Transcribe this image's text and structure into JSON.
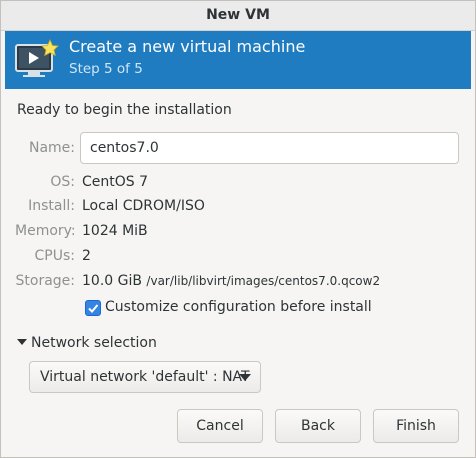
{
  "window": {
    "title": "New VM"
  },
  "header": {
    "title": "Create a new virtual machine",
    "step": "Step 5 of 5",
    "icon": "computer-with-star-icon"
  },
  "summary": {
    "heading": "Ready to begin the installation",
    "name_label": "Name:",
    "name_value": "centos7.0",
    "os_label": "OS:",
    "os_value": "CentOS 7",
    "install_label": "Install:",
    "install_value": "Local CDROM/ISO",
    "memory_label": "Memory:",
    "memory_value": "1024 MiB",
    "cpus_label": "CPUs:",
    "cpus_value": "2",
    "storage_label": "Storage:",
    "storage_size": "10.0 GiB",
    "storage_path": "/var/lib/libvirt/images/centos7.0.qcow2"
  },
  "customize": {
    "label": "Customize configuration before install",
    "checked": true
  },
  "network": {
    "expander_label": "Network selection",
    "expanded": true,
    "selected": "Virtual network 'default' : NAT"
  },
  "buttons": {
    "cancel": "Cancel",
    "back": "Back",
    "finish": "Finish"
  },
  "colors": {
    "header_bg": "#1f7cc1",
    "checkbox_accent": "#3584e4"
  }
}
